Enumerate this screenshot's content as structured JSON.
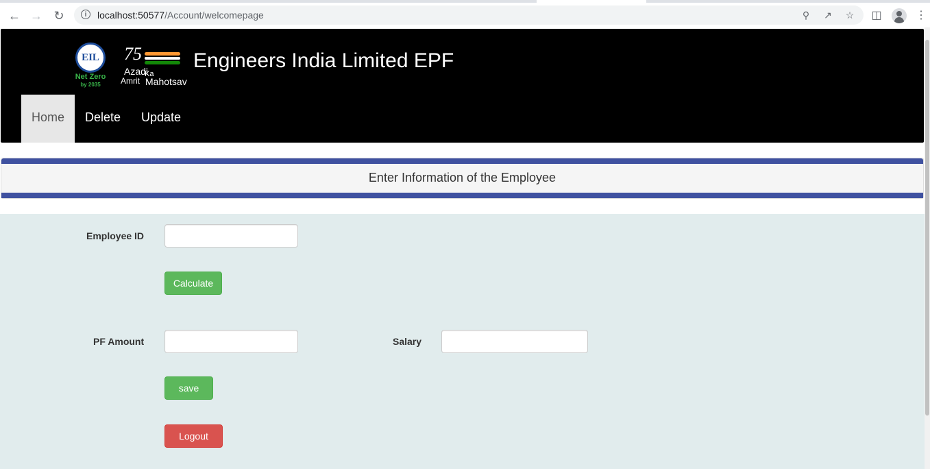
{
  "browser": {
    "url_host": "localhost:50577",
    "url_path": "/Account/welcomepage"
  },
  "header": {
    "logo_text": "EIL",
    "logo_tagline": "Net Zero",
    "logo_year": "by 2035",
    "azadi_number": "75",
    "azadi_word1": "Azadi",
    "azadi_word2": "Ka",
    "azadi_word3": "Amrit",
    "azadi_word4": "Mahotsav",
    "title": "Engineers India Limited EPF"
  },
  "nav": {
    "items": [
      {
        "label": "Home",
        "active": true
      },
      {
        "label": "Delete",
        "active": false
      },
      {
        "label": "Update",
        "active": false
      }
    ]
  },
  "panel": {
    "title": "Enter Information of the Employee"
  },
  "form": {
    "employee_id_label": "Employee ID",
    "employee_id_value": "",
    "calculate_label": "Calculate",
    "pf_amount_label": "PF Amount",
    "pf_amount_value": "",
    "salary_label": "Salary",
    "salary_value": "",
    "save_label": "save",
    "logout_label": "Logout"
  },
  "colors": {
    "header_bg": "#000000",
    "panel_accent": "#3f51a0",
    "form_bg": "#e1eced",
    "success": "#5cb85c",
    "danger": "#d9534f"
  }
}
